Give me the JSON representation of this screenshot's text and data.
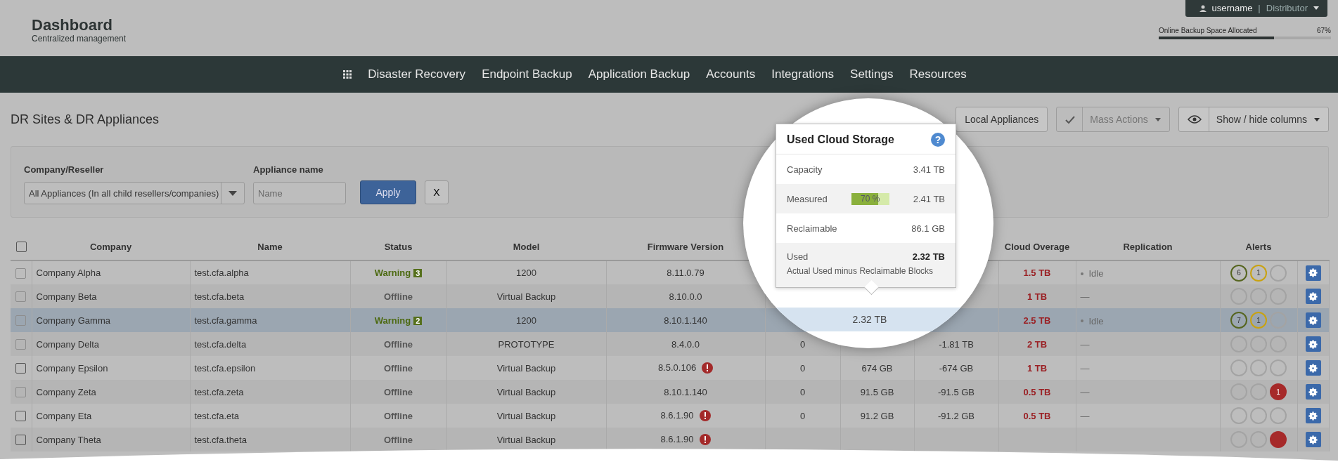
{
  "header": {
    "title": "Dashboard",
    "subtitle": "Centralized management",
    "user": {
      "name": "username",
      "separator": "|",
      "role": "Distributor"
    },
    "space": {
      "label": "Online Backup Space Allocated",
      "reading": "67%",
      "level": 0.67
    }
  },
  "nav": {
    "items": [
      "Disaster Recovery",
      "Endpoint Backup",
      "Application Backup",
      "Accounts",
      "Integrations",
      "Settings",
      "Resources"
    ]
  },
  "page_title": "DR Sites & DR Appliances",
  "toolbar": {
    "local_button": "Local Appliances",
    "mass_actions": {
      "label": "Mass Actions",
      "disabled": true
    },
    "columns_button": "Show / hide columns"
  },
  "filters": {
    "company_label": "Company/Reseller",
    "company_value": "All Appliances (In all child resellers/companies)",
    "name_label": "Appliance name",
    "name_placeholder": "Name",
    "apply": "Apply",
    "clear": "X"
  },
  "table": {
    "select_all": {
      "checked": false
    },
    "columns": [
      {
        "label": "Company"
      },
      {
        "label": "Name"
      },
      {
        "label": "Status"
      },
      {
        "label": "Model"
      },
      {
        "label": "Firmware Version"
      },
      null,
      null,
      null,
      {
        "label": "Cloud Overage"
      },
      {
        "label": "Replication"
      },
      {
        "label": "Alerts"
      }
    ],
    "rows": [
      {
        "selected": false,
        "checkbox_disabled": true,
        "company": "Company Alpha",
        "name": "test.cfa.alpha",
        "status": {
          "kind": "warning",
          "text": "Warning",
          "count": "3"
        },
        "model": "1200",
        "firmware": "8.11.0.79",
        "firmware_alert": false,
        "overage": "1.5 TB",
        "replication": {
          "text": "Idle",
          "dot": true
        },
        "alerts": [
          {
            "color": "#56651f",
            "text": "6",
            "filled": false
          },
          {
            "color": "#c9a20f",
            "text": "1",
            "filled": false
          },
          {
            "color": "#a3a3a3",
            "filled": false
          }
        ]
      },
      {
        "selected": false,
        "checkbox_disabled": true,
        "company": "Company Beta",
        "name": "test.cfa.beta",
        "status": {
          "kind": "offline",
          "text": "Offline"
        },
        "model": "Virtual Backup",
        "firmware": "8.10.0.0",
        "firmware_alert": false,
        "overage": "1 TB",
        "replication": {
          "text": "—",
          "dot": false
        },
        "alerts": [
          {
            "color": "#a3a3a3",
            "filled": false
          },
          {
            "color": "#a3a3a3",
            "filled": false
          },
          {
            "color": "#a3a3a3",
            "filled": false
          }
        ]
      },
      {
        "selected": true,
        "checkbox_disabled": true,
        "company": "Company Gamma",
        "name": "test.cfa.gamma",
        "status": {
          "kind": "warning",
          "text": "Warning",
          "count": "2"
        },
        "model": "1200",
        "firmware": "8.10.1.140",
        "firmware_alert": false,
        "overage": "2.5 TB",
        "replication": {
          "text": "Idle",
          "dot": true
        },
        "alerts": [
          {
            "color": "#56651f",
            "text": "7",
            "filled": false
          },
          {
            "color": "#c9a20f",
            "text": "1",
            "filled": false
          },
          {
            "color": "#a3a3a3",
            "filled": false
          }
        ]
      },
      {
        "selected": false,
        "checkbox_disabled": true,
        "company": "Company Delta",
        "name": "test.cfa.delta",
        "status": {
          "kind": "offline",
          "text": "Offline"
        },
        "model": "PROTOTYPE",
        "firmware": "8.4.0.0",
        "firmware_alert": false,
        "public_cloud": "0",
        "balance": "-1.81 TB",
        "overage": "2 TB",
        "replication": {
          "text": "—",
          "dot": false
        },
        "alerts": [
          {
            "color": "#a3a3a3",
            "filled": false
          },
          {
            "color": "#a3a3a3",
            "filled": false
          },
          {
            "color": "#a3a3a3",
            "filled": false
          }
        ]
      },
      {
        "selected": false,
        "checkbox_disabled": false,
        "company": "Company Epsilon",
        "name": "test.cfa.epsilon",
        "status": {
          "kind": "offline",
          "text": "Offline"
        },
        "model": "Virtual Backup",
        "firmware": "8.5.0.106",
        "firmware_alert": true,
        "public_cloud": "0",
        "used": "674 GB",
        "balance": "-674 GB",
        "overage": "1 TB",
        "replication": {
          "text": "—",
          "dot": false
        },
        "alerts": [
          {
            "color": "#a3a3a3",
            "filled": false
          },
          {
            "color": "#a3a3a3",
            "filled": false
          },
          {
            "color": "#a3a3a3",
            "filled": false
          }
        ]
      },
      {
        "selected": false,
        "checkbox_disabled": true,
        "company": "Company Zeta",
        "name": "test.cfa.zeta",
        "status": {
          "kind": "offline",
          "text": "Offline"
        },
        "model": "Virtual Backup",
        "firmware": "8.10.1.140",
        "firmware_alert": false,
        "public_cloud": "0",
        "used": "91.5 GB",
        "balance": "-91.5 GB",
        "overage": "0.5 TB",
        "replication": {
          "text": "—",
          "dot": false
        },
        "alerts": [
          {
            "color": "#a3a3a3",
            "filled": false
          },
          {
            "color": "#a3a3a3",
            "filled": false
          },
          {
            "color": "#a62a2a",
            "text": "1",
            "filled": true
          }
        ]
      },
      {
        "selected": false,
        "checkbox_disabled": false,
        "company": "Company Eta",
        "name": "test.cfa.eta",
        "status": {
          "kind": "offline",
          "text": "Offline"
        },
        "model": "Virtual Backup",
        "firmware": "8.6.1.90",
        "firmware_alert": true,
        "public_cloud": "0",
        "used": "91.2 GB",
        "balance": "-91.2 GB",
        "overage": "0.5 TB",
        "replication": {
          "text": "—",
          "dot": false
        },
        "alerts": [
          {
            "color": "#a3a3a3",
            "filled": false
          },
          {
            "color": "#a3a3a3",
            "filled": false
          },
          {
            "color": "#a3a3a3",
            "filled": false
          }
        ]
      },
      {
        "selected": false,
        "checkbox_disabled": false,
        "company": "Company Theta",
        "name": "test.cfa.theta",
        "status": {
          "kind": "offline",
          "text": "Offline"
        },
        "model": "Virtual Backup",
        "firmware": "8.6.1.90",
        "firmware_alert": true,
        "alerts": [
          {
            "color": "#a3a3a3",
            "filled": false
          },
          {
            "color": "#a3a3a3",
            "filled": false
          },
          {
            "color": "#a62a2a",
            "filled": true
          }
        ]
      }
    ]
  },
  "magnifier": {
    "cell": "2.32 TB",
    "popover": {
      "title": "Used Cloud Storage",
      "help": "?",
      "rows": [
        {
          "kind": "plain",
          "label": "Capacity",
          "value": "3.41 TB"
        },
        {
          "kind": "meter",
          "label": "Measured",
          "value": "2.41 TB",
          "level": 0.7,
          "reading": "70 %"
        },
        {
          "kind": "plain",
          "label": "Reclaimable",
          "value": "86.1 GB"
        },
        {
          "kind": "total",
          "label": "Used",
          "value": "2.32 TB",
          "note": "Actual Used minus Reclaimable Blocks"
        }
      ]
    }
  }
}
